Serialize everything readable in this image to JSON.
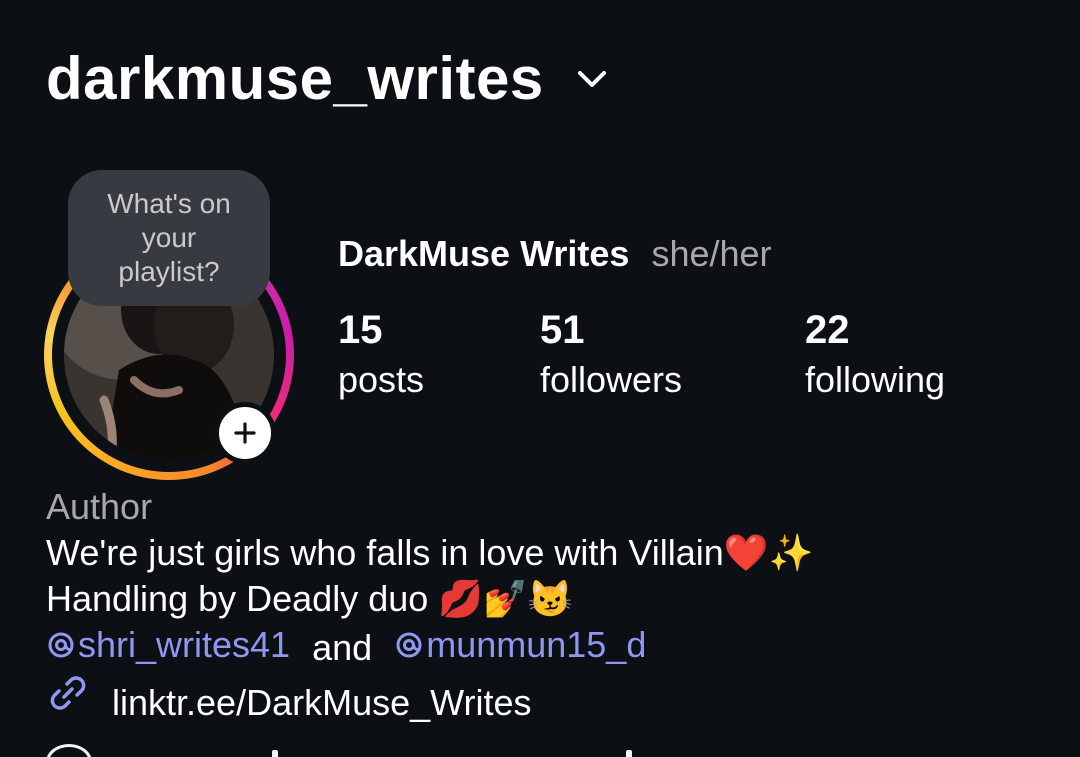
{
  "header": {
    "username": "darkmuse_writes",
    "switch_icon": "chevron-down-icon"
  },
  "profile": {
    "note_bubble": "What's on your playlist?",
    "display_name": "DarkMuse Writes",
    "pronouns": "she/her",
    "avatar_ring_colors": [
      "#f9a42a",
      "#ee2a7b",
      "#c91fa6"
    ],
    "add_icon": "plus-icon"
  },
  "stats": {
    "posts": {
      "value": "15",
      "label": "posts"
    },
    "followers": {
      "value": "51",
      "label": "followers"
    },
    "following": {
      "value": "22",
      "label": "following"
    }
  },
  "bio": {
    "category": "Author",
    "line1": "We're just girls who falls in love with Villain❤️✨",
    "line2": "Handling by Deadly duo 💋💅😼",
    "mention1": "shri_writes41",
    "connector": "and",
    "mention2": "munmun15_d",
    "link": "linktr.ee/DarkMuse_Writes",
    "link_icon": "link-icon",
    "mention_icon": "threads-icon"
  },
  "colors": {
    "background": "#0c0f14",
    "link": "#8f97f2",
    "secondary_text": "#a8a8a8",
    "bubble": "#373a40"
  }
}
